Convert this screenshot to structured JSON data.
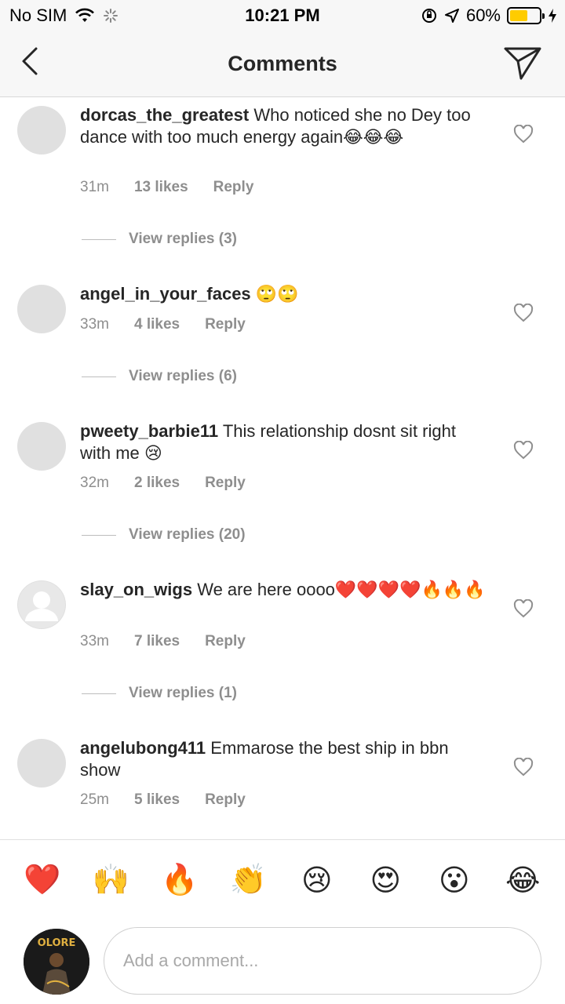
{
  "status_bar": {
    "carrier": "No SIM",
    "time": "10:21 PM",
    "battery_percent": "60%",
    "battery_level": 0.6,
    "battery_color": "#ffcc00"
  },
  "header": {
    "title": "Comments",
    "back_icon": "chevron-left-icon",
    "send_icon": "paper-plane-icon"
  },
  "comments": [
    {
      "username": "dorcas_the_greatest",
      "text": "Who noticed she no Dey too dance with too much energy again😂😂😂",
      "time": "31m",
      "likes": "13 likes",
      "reply": "Reply",
      "view_replies": "View replies (3)"
    },
    {
      "username": "angel_in_your_faces",
      "text": "🙄🙄",
      "time": "33m",
      "likes": "4 likes",
      "reply": "Reply",
      "view_replies": "View replies (6)"
    },
    {
      "username": "pweety_barbie11",
      "text": "This relationship dosnt sit right with me 😢",
      "time": "32m",
      "likes": "2 likes",
      "reply": "Reply",
      "view_replies": "View replies (20)"
    },
    {
      "username": "slay_on_wigs",
      "text": "We are here oooo❤️❤️❤️❤️🔥🔥🔥",
      "time": "33m",
      "likes": "7 likes",
      "reply": "Reply",
      "view_replies": "View replies (1)"
    },
    {
      "username": "angelubong411",
      "text": "Emmarose the best ship in bbn show",
      "time": "25m",
      "likes": "5 likes",
      "reply": "Reply"
    }
  ],
  "emoji_bar": [
    "❤️",
    "🙌",
    "🔥",
    "👏",
    "😢",
    "😍",
    "😮",
    "😂"
  ],
  "input": {
    "placeholder": "Add a comment...",
    "avatar_text": "OLORE"
  }
}
